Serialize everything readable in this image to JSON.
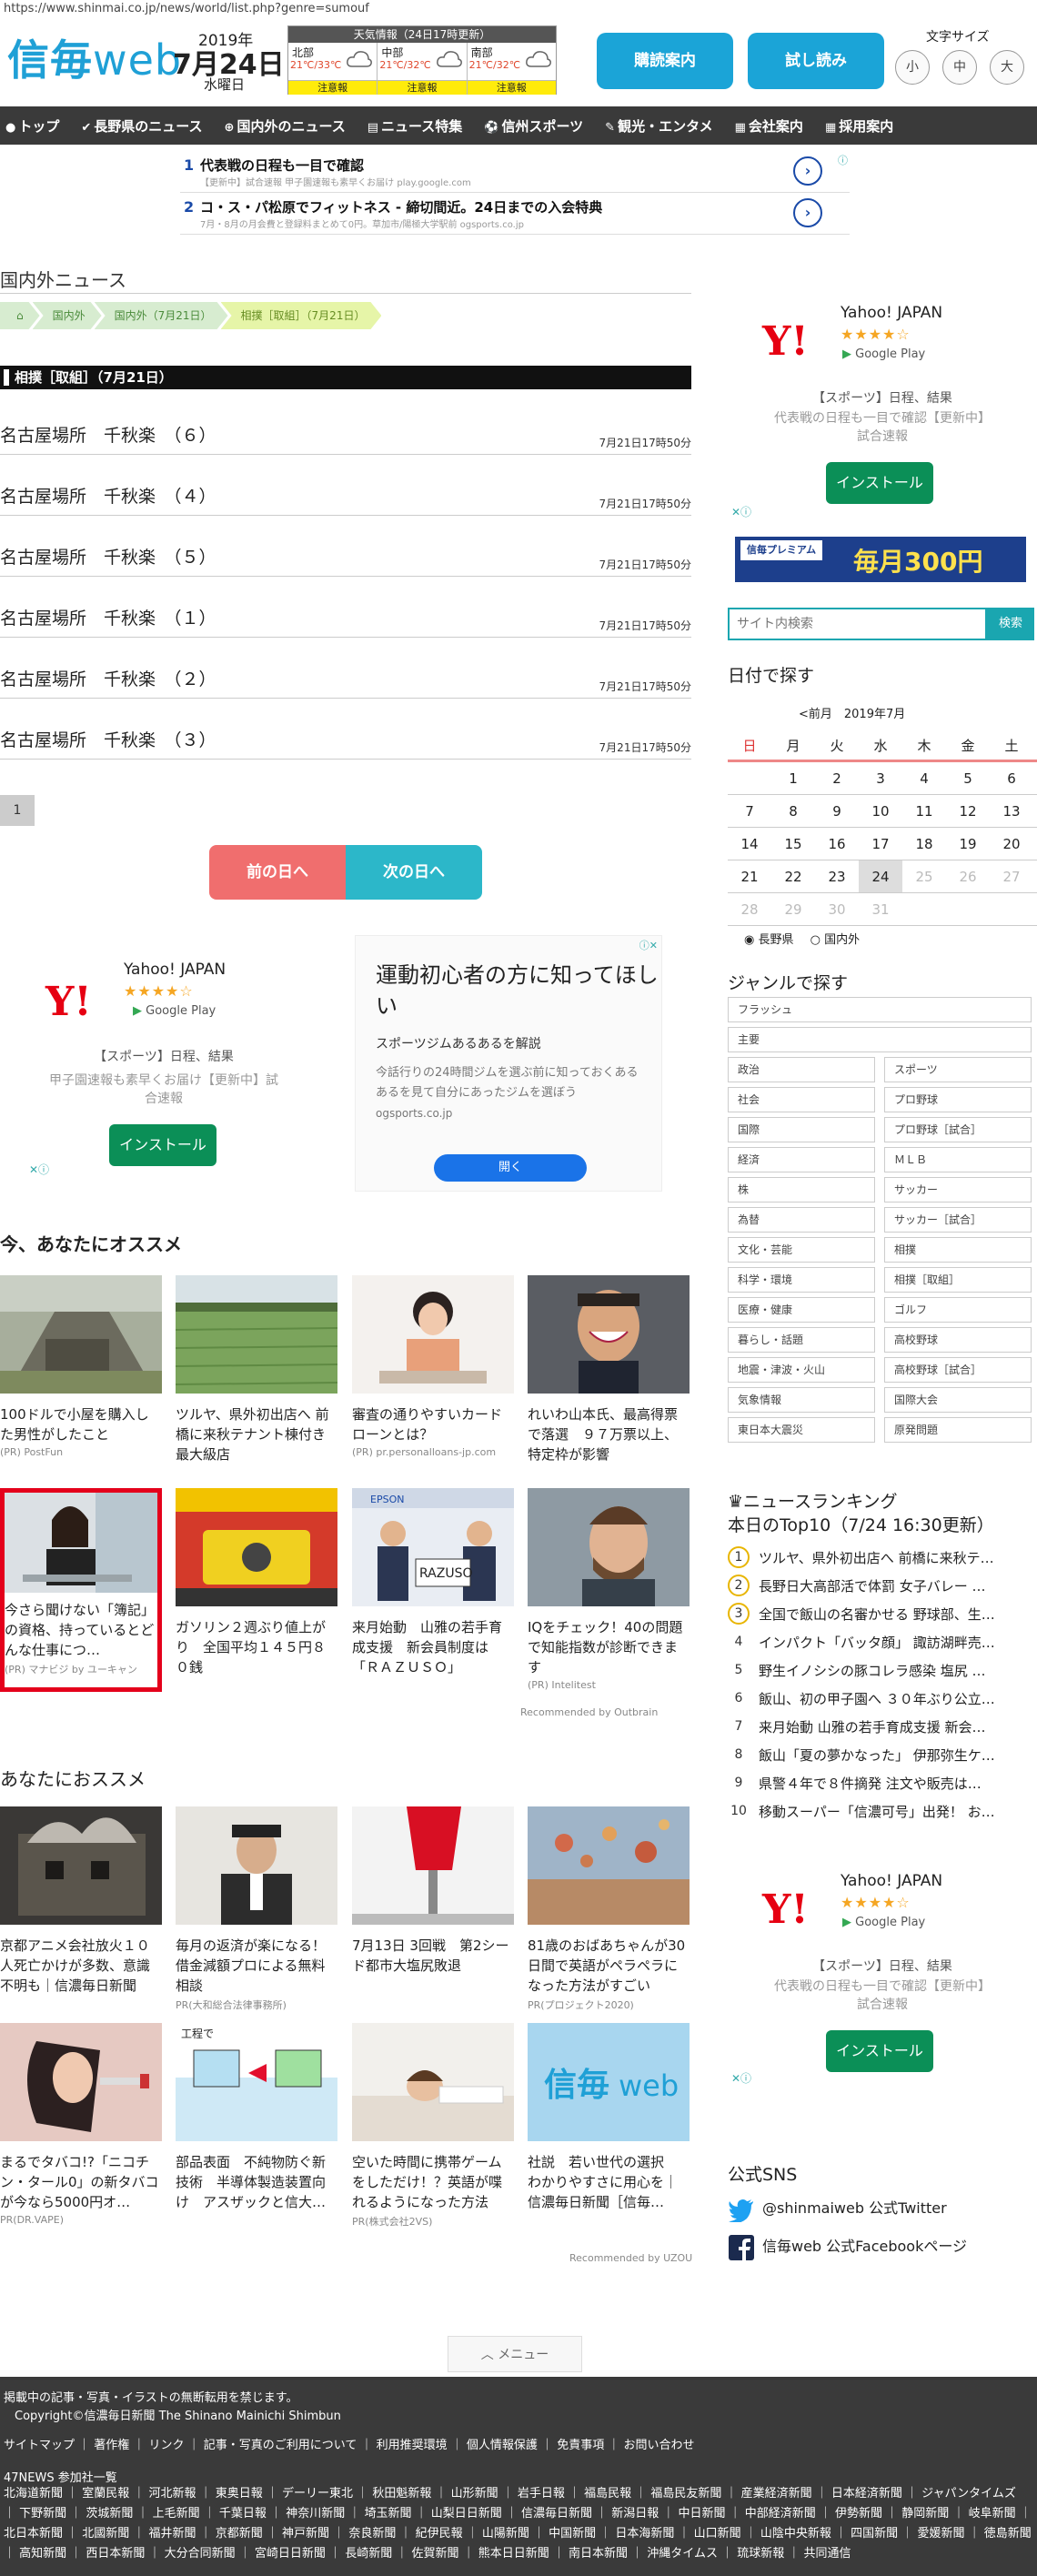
{
  "url": "https://www.shinmai.co.jp/news/world/list.php?genre=sumouf",
  "header": {
    "logo_main": "信毎",
    "logo_web": "web",
    "year": "2019年",
    "day": "7月24日",
    "weekday": "水曜日",
    "weather_title": "天気情報（24日17時更新）",
    "weather": [
      {
        "name": "北部",
        "temp": "21℃/33℃",
        "warn": "注意報"
      },
      {
        "name": "中部",
        "temp": "21℃/32℃",
        "warn": "注意報"
      },
      {
        "name": "南部",
        "temp": "21℃/32℃",
        "warn": "注意報"
      }
    ],
    "subscribe_label": "購読案内",
    "trial_label": "試し読み",
    "font_size_label": "文字サイズ",
    "font_sizes": [
      "小",
      "中",
      "大"
    ]
  },
  "nav": [
    {
      "icon": "●",
      "label": "トップ"
    },
    {
      "icon": "✔",
      "label": "長野県のニュース"
    },
    {
      "icon": "⊕",
      "label": "国内外のニュース"
    },
    {
      "icon": "▤",
      "label": "ニュース特集"
    },
    {
      "icon": "⚽",
      "label": "信州スポーツ"
    },
    {
      "icon": "✎",
      "label": "観光・エンタメ"
    },
    {
      "icon": "▦",
      "label": "会社案内"
    },
    {
      "icon": "▦",
      "label": "採用案内"
    }
  ],
  "top_ads": [
    {
      "num": "1",
      "title": "代表戦の日程も一目で確認",
      "sub": "【更新中】試合速報 甲子園速報も素早くお届け play.google.com"
    },
    {
      "num": "2",
      "title": "コ・ス・パ松原でフィットネス - 締切間近。24日までの入会特典",
      "sub": "7月・8月の月会費と登録料まとめて0円。草加市/陽極大学駅前 ogsports.co.jp"
    }
  ],
  "main": {
    "section_title": "国内外ニュース",
    "breadcrumb": [
      "国内外",
      "国内外（7月21日）",
      "相撲［取組］（7月21日）"
    ],
    "category": "相撲［取組］（7月21日）",
    "news": [
      {
        "title": "名古屋場所　千秋楽　（６）",
        "date": "7月21日17時50分"
      },
      {
        "title": "名古屋場所　千秋楽　（４）",
        "date": "7月21日17時50分"
      },
      {
        "title": "名古屋場所　千秋楽　（５）",
        "date": "7月21日17時50分"
      },
      {
        "title": "名古屋場所　千秋楽　（１）",
        "date": "7月21日17時50分"
      },
      {
        "title": "名古屋場所　千秋楽　（２）",
        "date": "7月21日17時50分"
      },
      {
        "title": "名古屋場所　千秋楽　（３）",
        "date": "7月21日17時50分"
      }
    ],
    "page": "1",
    "prev_label": "前の日へ",
    "next_label": "次の日へ"
  },
  "yahoo_ad": {
    "logo": "Y!",
    "name": "Yahoo! JAPAN",
    "stars": "★★★★☆",
    "store": "Google Play",
    "desc": "【スポーツ】日程、結果",
    "desc2_main": "甲子園速報も素早くお届け【更新中】試合速報",
    "desc2_side": "代表戦の日程も一目で確認【更新中】試合速報",
    "install": "インストール"
  },
  "gym_ad": {
    "headline": "運動初心者の方に知ってほしい",
    "sub": "スポーツジムあるあるを解説",
    "body": "今話行りの24時間ジムを選ぶ前に知っておくあるあるを見て自分にあったジムを選ぼう",
    "domain": "ogsports.co.jp",
    "open": "開く"
  },
  "rec1": {
    "title": "今、あなたにオススメ",
    "items": [
      {
        "title": "100ドルで小屋を購入した男性がしたこと",
        "source": "(PR) PostFun"
      },
      {
        "title": "ツルヤ、県外初出店へ 前橋に来秋テナント棟付き最大級店",
        "source": ""
      },
      {
        "title": "審査の通りやすいカードローンとは？",
        "source": "(PR) pr.personalloans-jp.com"
      },
      {
        "title": "れいわ山本氏、最高得票で落選　９７万票以上、特定枠が影響",
        "source": ""
      },
      {
        "title": "今さら聞けない「簿記」の資格、持っているとどんな仕事につ…",
        "source": "(PR) マナビジ by ユーキャン"
      },
      {
        "title": "ガソリン２週ぶり値上がり　全国平均１４５円８０銭",
        "source": ""
      },
      {
        "title": "来月始動　山雅の若手育成支援　新会員制度は「ＲＡＺＵＳＯ」",
        "source": ""
      },
      {
        "title": "IQをチェック！40の問題で知能指数が診断できます",
        "source": "(PR) Intelitest"
      }
    ],
    "credit": "Recommended by Outbrain"
  },
  "rec2": {
    "title": "あなたにおススメ",
    "items": [
      {
        "title": "京都アニメ会社放火１０人死亡かけが多数、意識不明も｜信濃毎日新聞",
        "source": ""
      },
      {
        "title": "毎月の返済が楽になる！借金減額プロによる無料相談",
        "source": "PR(大和総合法律事務所)"
      },
      {
        "title": "7月13日 3回戦　第2シード都市大塩尻敗退",
        "source": ""
      },
      {
        "title": "81歳のおばあちゃんが30日間で英語がペラペラになった方法がすごい",
        "source": "PR(プロジェクト2020)"
      },
      {
        "title": "まるでタバコ!?「ニコチン・タール0」の新タバコが今なら5000円オ…",
        "source": "PR(DR.VAPE)"
      },
      {
        "title": "部品表面　不純物防ぐ新技術　半導体製造装置向け　アスザックと信大…",
        "source": ""
      },
      {
        "title": "空いた時間に携帯ゲームをしただけ！？英語が喋れるようになった方法",
        "source": "PR(株式会社2VS)"
      },
      {
        "title": "社説　若い世代の選択　わかりやすさに用心を｜信濃毎日新聞［信毎…",
        "source": ""
      }
    ],
    "credit": "Recommended by UZOU"
  },
  "side": {
    "search_placeholder": "サイト内検索",
    "search_btn": "検索",
    "date_title": "日付で探す",
    "cal_nav": "<前月　2019年7月",
    "weekdays": [
      "日",
      "月",
      "火",
      "水",
      "木",
      "金",
      "土"
    ],
    "weeks": [
      [
        "",
        "1",
        "2",
        "3",
        "4",
        "5",
        "6"
      ],
      [
        "7",
        "8",
        "9",
        "10",
        "11",
        "12",
        "13"
      ],
      [
        "14",
        "15",
        "16",
        "17",
        "18",
        "19",
        "20"
      ],
      [
        "21",
        "22",
        "23",
        "24",
        "25",
        "26",
        "27"
      ],
      [
        "28",
        "29",
        "30",
        "31",
        "",
        "",
        ""
      ]
    ],
    "today": "24",
    "regions": [
      "長野県",
      "国内外"
    ],
    "genre_title": "ジャンルで探す",
    "genres_full": [
      "フラッシュ",
      "主要"
    ],
    "genres": [
      [
        "政治",
        "スポーツ"
      ],
      [
        "社会",
        "プロ野球"
      ],
      [
        "国際",
        "プロ野球［試合］"
      ],
      [
        "経済",
        "ＭＬＢ"
      ],
      [
        "株",
        "サッカー"
      ],
      [
        "為替",
        "サッカー［試合］"
      ],
      [
        "文化・芸能",
        "相撲"
      ],
      [
        "科学・環境",
        "相撲［取組］"
      ],
      [
        "医療・健康",
        "ゴルフ"
      ],
      [
        "暮らし・話題",
        "高校野球"
      ],
      [
        "地震・津波・火山",
        "高校野球［試合］"
      ],
      [
        "気象情報",
        "国際大会"
      ],
      [
        "東日本大震災",
        "原発問題"
      ]
    ],
    "rank_title": "ニュースランキング",
    "rank_sub": "本日のTop10（7/24 16:30更新）",
    "ranking": [
      "ツルヤ、県外初出店へ 前橋に来秋テ…",
      "長野日大高部活で体罰 女子バレー …",
      "全国で飯山の名審かせる 野球部、生…",
      "インパクト「バッタ顔」 諏訪湖畔売…",
      "野生イノシシの豚コレラ感染 塩尻 …",
      "飯山、初の甲子園へ ３０年ぶり公立…",
      "来月始動 山雅の若手育成支援 新会…",
      "飯山「夏の夢かなった」 伊那弥生ケ…",
      "県警４年で８件摘発 注文や販売は…",
      "移動スーパー「信濃可号」出発！ お…"
    ],
    "banner_text": "毎月300円",
    "banner_sub": "信毎プレミアム",
    "sns_title": "公式SNS",
    "twitter": "@shinmaiweb 公式Twitter",
    "facebook": "信毎web 公式Facebookページ"
  },
  "footer": {
    "notice": "掲載中の記事・写真・イラストの無断転用を禁じます。",
    "copyright": "Copyright©信濃毎日新聞 The Shinano Mainichi Shimbun",
    "links": "サイトマップ ｜ 著作権 ｜ リンク ｜ 記事・写真のご利用について ｜ 利用推奨環境 ｜ 個人情報保護 ｜ 免責事項 ｜ お問い合わせ",
    "news47": "47NEWS 参加社一覧",
    "members": "北海道新聞 ｜ 室蘭民報 ｜ 河北新報 ｜ 東奥日報 ｜ デーリー東北 ｜ 秋田魁新報 ｜ 山形新聞 ｜ 岩手日報 ｜ 福島民報 ｜ 福島民友新聞 ｜ 産業経済新聞 ｜ 日本経済新聞 ｜ ジャパンタイムズ ｜ 下野新聞 ｜ 茨城新聞 ｜ 上毛新聞 ｜ 千葉日報 ｜ 神奈川新聞 ｜ 埼玉新聞 ｜ 山梨日日新聞 ｜ 信濃毎日新聞 ｜ 新潟日報 ｜ 中日新聞 ｜ 中部経済新聞 ｜ 伊勢新聞 ｜ 静岡新聞 ｜ 岐阜新聞 ｜ 北日本新聞 ｜ 北國新聞 ｜ 福井新聞 ｜ 京都新聞 ｜ 神戸新聞 ｜ 奈良新聞 ｜ 紀伊民報 ｜ 山陽新聞 ｜ 中国新聞 ｜ 日本海新聞 ｜ 山口新聞 ｜ 山陰中央新報 ｜ 四国新聞 ｜ 愛媛新聞 ｜ 徳島新聞 ｜ 高知新聞 ｜ 西日本新聞 ｜ 大分合同新聞 ｜ 宮崎日日新聞 ｜ 長崎新聞 ｜ 佐賀新聞 ｜ 熊本日日新聞 ｜ 南日本新聞 ｜ 沖縄タイムス ｜ 琉球新報 ｜ 共同通信"
  },
  "menu_label": "メニュー"
}
